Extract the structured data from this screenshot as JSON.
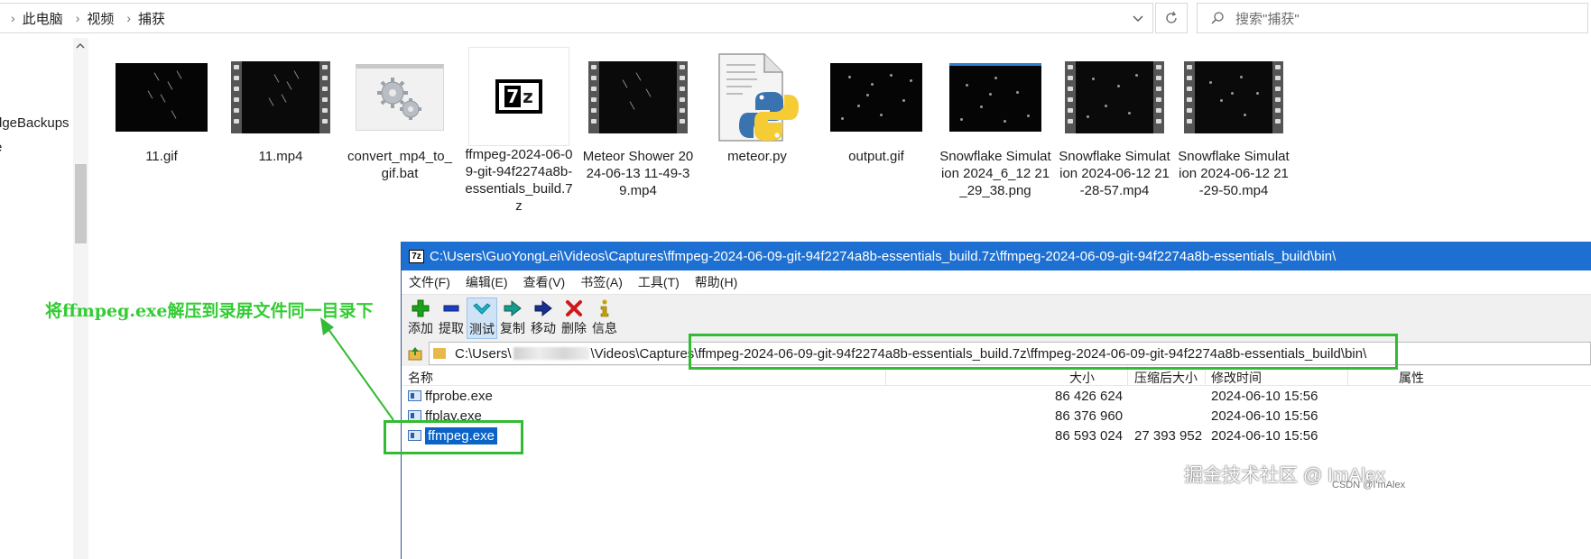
{
  "explorer": {
    "breadcrumbs": [
      "此电脑",
      "视频",
      "捕获"
    ],
    "search_placeholder": "搜索\"捕获\"",
    "nav_items": [
      "dgeBackups",
      "e"
    ]
  },
  "files": [
    {
      "name": "11.gif",
      "thumb": "black-streaks"
    },
    {
      "name": "11.mp4",
      "thumb": "video-streaks"
    },
    {
      "name": "convert_mp4_to_gif.bat",
      "thumb": "gears-icon"
    },
    {
      "name": "ffmpeg-2024-06-09-git-94f2274a8b-essentials_build.7z",
      "thumb": "7z-icon"
    },
    {
      "name": "Meteor Shower 2024-06-13 11-49-39.mp4",
      "thumb": "video-streaks"
    },
    {
      "name": "meteor.py",
      "thumb": "python-icon"
    },
    {
      "name": "output.gif",
      "thumb": "black-dots"
    },
    {
      "name": "Snowflake Simulation 2024_6_12 21_29_38.png",
      "thumb": "black-dots-bar"
    },
    {
      "name": "Snowflake Simulation 2024-06-12 21-28-57.mp4",
      "thumb": "video-dots"
    },
    {
      "name": "Snowflake Simulation 2024-06-12 21-29-50.mp4",
      "thumb": "video-dots"
    }
  ],
  "sevenzip": {
    "logo": "7z",
    "title": "C:\\Users\\GuoYongLei\\Videos\\Captures\\ffmpeg-2024-06-09-git-94f2274a8b-essentials_build.7z\\ffmpeg-2024-06-09-git-94f2274a8b-essentials_build\\bin\\",
    "menu": [
      "文件(F)",
      "编辑(E)",
      "查看(V)",
      "书签(A)",
      "工具(T)",
      "帮助(H)"
    ],
    "tools": [
      {
        "label": "添加",
        "icon": "plus-icon",
        "color": "#1aa31a"
      },
      {
        "label": "提取",
        "icon": "minus-icon",
        "color": "#1a3fbf"
      },
      {
        "label": "测试",
        "icon": "check-icon",
        "color": "#19b3c8"
      },
      {
        "label": "复制",
        "icon": "copy-arrow-icon",
        "color": "#1a9a8a"
      },
      {
        "label": "移动",
        "icon": "move-arrow-icon",
        "color": "#1a2f8f"
      },
      {
        "label": "删除",
        "icon": "delete-x-icon",
        "color": "#d01818"
      },
      {
        "label": "信息",
        "icon": "info-icon",
        "color": "#c8a000"
      }
    ],
    "path_prefix": "C:\\Users\\",
    "path_mid": "\\Videos\\Captures\\",
    "path_rest": "ffmpeg-2024-06-09-git-94f2274a8b-essentials_build.7z\\ffmpeg-2024-06-09-git-94f2274a8b-essentials_build\\bin\\",
    "columns": {
      "name": "名称",
      "size": "大小",
      "packed": "压缩后大小",
      "modified": "修改时间",
      "attr": "属性"
    },
    "rows": [
      {
        "name": "ffprobe.exe",
        "size": "86 426 624",
        "packed": "",
        "modified": "2024-06-10 15:56"
      },
      {
        "name": "ffplay.exe",
        "size": "86 376 960",
        "packed": "",
        "modified": "2024-06-10 15:56"
      },
      {
        "name": "ffmpeg.exe",
        "size": "86 593 024",
        "packed": "27 393 952",
        "modified": "2024-06-10 15:56"
      }
    ]
  },
  "annotation": {
    "text": "将ffmpeg.exe解压到录屏文件同一目录下",
    "color": "#33cc33"
  },
  "watermark": {
    "main": "掘金技术社区 @ ImAlex",
    "sub": "CSDN @I'mAlex"
  }
}
